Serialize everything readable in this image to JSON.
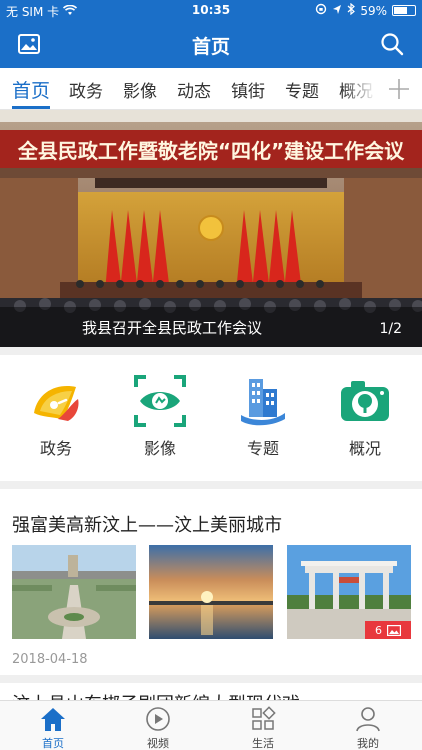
{
  "status_bar": {
    "carrier": "无 SIM 卡",
    "time": "10:35",
    "battery": "59%"
  },
  "navbar": {
    "title": "首页"
  },
  "tabs": [
    {
      "label": "首页"
    },
    {
      "label": "政务"
    },
    {
      "label": "影像"
    },
    {
      "label": "动态"
    },
    {
      "label": "镇街"
    },
    {
      "label": "专题"
    },
    {
      "label": "概况"
    }
  ],
  "banner": {
    "headline_text": "全县民政工作暨敬老院“四化”建设工作会议",
    "caption": "我县召开全县民政工作会议",
    "pager": "1/2"
  },
  "quick_menu": [
    {
      "label": "政务",
      "icon": "scroll-icon"
    },
    {
      "label": "影像",
      "icon": "eye-scan-icon"
    },
    {
      "label": "专题",
      "icon": "buildings-icon"
    },
    {
      "label": "概况",
      "icon": "camera-tree-icon"
    }
  ],
  "article": {
    "title": "强富美高新汶上——汶上美丽城市",
    "photo_count": "6",
    "date": "2018-04-18"
  },
  "article2": {
    "title": "汶上县山东梆子剧团新编大型现代戏"
  },
  "tabbar": [
    {
      "label": "首页",
      "icon": "home-icon"
    },
    {
      "label": "视频",
      "icon": "play-icon"
    },
    {
      "label": "生活",
      "icon": "grid-icon"
    },
    {
      "label": "我的",
      "icon": "person-icon"
    }
  ],
  "colors": {
    "brand": "#1b6fc8",
    "badge": "#e8383d",
    "green": "#1aa57a"
  }
}
